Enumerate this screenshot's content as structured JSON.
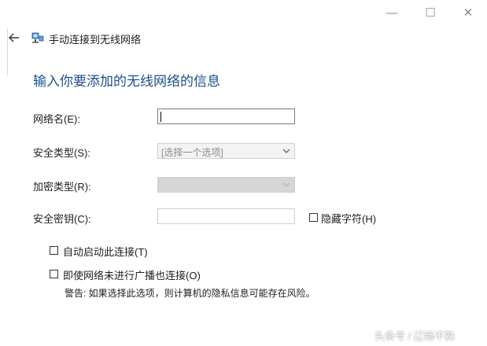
{
  "window": {
    "title": "手动连接到无线网络",
    "controls": {
      "minimize": "—",
      "maximize": "☐",
      "close": "✕"
    }
  },
  "icons": {
    "back": "back-arrow-icon",
    "network": "network-icon",
    "dropdown": "chevron-down-icon"
  },
  "heading": "输入你要添加的无线网络的信息",
  "form": {
    "network_name": {
      "label": "网络名(E):",
      "value": ""
    },
    "security_type": {
      "label": "安全类型(S):",
      "value": "[选择一个选项]"
    },
    "encryption_type": {
      "label": "加密类型(R):",
      "value": ""
    },
    "security_key": {
      "label": "安全密钥(C):",
      "value": ""
    },
    "hide_chars": {
      "label": "隐藏字符(H)",
      "checked": false
    }
  },
  "options": {
    "auto_connect": {
      "label": "自动启动此连接(T)",
      "checked": false
    },
    "connect_hidden": {
      "label": "即使网络未进行广播也连接(O)",
      "checked": false
    },
    "warning": "警告: 如果选择此选项，则计算机的隐私信息可能存在风险。"
  },
  "watermark": "头条号 / 辽畅不熟"
}
